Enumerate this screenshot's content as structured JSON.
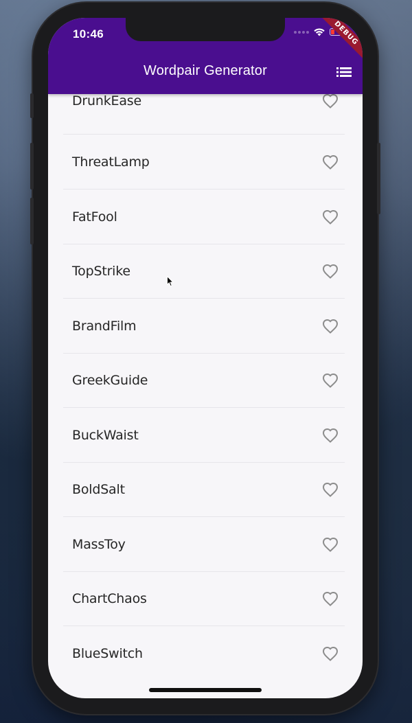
{
  "status_bar": {
    "time": "10:46",
    "debug_label": "DEBUG"
  },
  "app_bar": {
    "title": "Wordpair Generator",
    "menu_icon": "list-icon"
  },
  "list": {
    "items": [
      {
        "label": "DrunkEase",
        "favorite": false
      },
      {
        "label": "ThreatLamp",
        "favorite": false
      },
      {
        "label": "FatFool",
        "favorite": false
      },
      {
        "label": "TopStrike",
        "favorite": false
      },
      {
        "label": "BrandFilm",
        "favorite": false
      },
      {
        "label": "GreekGuide",
        "favorite": false
      },
      {
        "label": "BuckWaist",
        "favorite": false
      },
      {
        "label": "BoldSalt",
        "favorite": false
      },
      {
        "label": "MassToy",
        "favorite": false
      },
      {
        "label": "ChartChaos",
        "favorite": false
      },
      {
        "label": "BlueSwitch",
        "favorite": false
      }
    ],
    "item_icon": "heart-outline-icon"
  },
  "colors": {
    "app_bar": "#4a0e8f",
    "debug_banner": "#9a1a30",
    "background": "#f7f6f9",
    "text": "#262626",
    "heart": "#8c8c8c"
  }
}
